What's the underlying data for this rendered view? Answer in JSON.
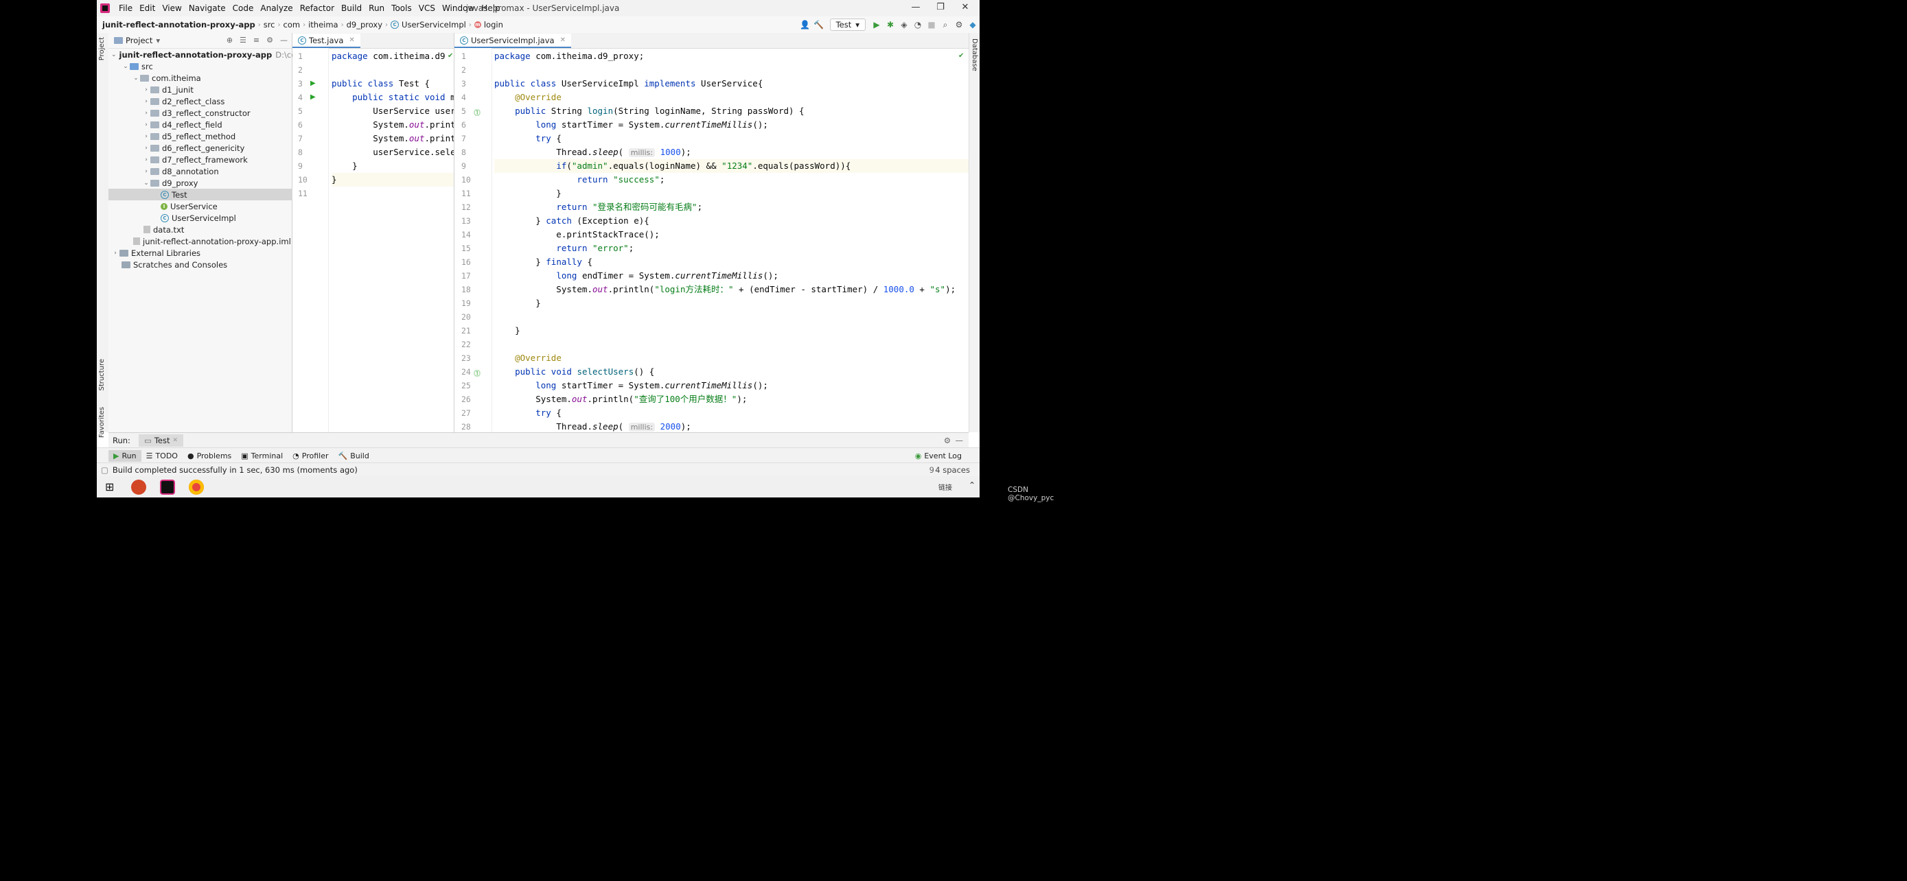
{
  "menu": [
    "File",
    "Edit",
    "View",
    "Navigate",
    "Code",
    "Analyze",
    "Refactor",
    "Build",
    "Run",
    "Tools",
    "VCS",
    "Window",
    "Help"
  ],
  "window_title": "javasepromax - UserServiceImpl.java",
  "breadcrumb": [
    "junit-reflect-annotation-proxy-app",
    "src",
    "com",
    "itheima",
    "d9_proxy",
    "UserServiceImpl",
    "login"
  ],
  "run_config": "Test",
  "project_panel": {
    "title": "Project",
    "root_name": "junit-reflect-annotation-proxy-app",
    "root_path": "D:\\code\\j",
    "src": "src",
    "package": "com.itheima",
    "folders": [
      "d1_junit",
      "d2_reflect_class",
      "d3_reflect_constructor",
      "d4_reflect_field",
      "d5_reflect_method",
      "d6_reflect_genericity",
      "d7_reflect_framework",
      "d8_annotation",
      "d9_proxy"
    ],
    "classes": [
      "Test",
      "UserService",
      "UserServiceImpl"
    ],
    "data_file": "data.txt",
    "iml_file": "junit-reflect-annotation-proxy-app.iml",
    "external_libraries": "External Libraries",
    "scratches": "Scratches and Consoles"
  },
  "left_tabs": {
    "project": "Project",
    "structure": "Structure",
    "favorites": "Favorites"
  },
  "right_tabs": {
    "database": "Database"
  },
  "editor_left": {
    "tab": "Test.java",
    "lines": [
      "package com.itheima.d9",
      "",
      "public class Test {",
      "    public static void m",
      "        UserService user",
      "        System.out.print",
      "        System.out.print",
      "        userService.sele",
      "    }",
      "}",
      ""
    ]
  },
  "editor_right": {
    "tab": "UserServiceImpl.java",
    "line_count": 28,
    "lines": {
      "l1_pkg": "package",
      "l1_rest": " com.itheima.d9_proxy;",
      "l3": "implements",
      "l5_login": "login",
      "l6_method": "currentTimeMillis",
      "l8_hint": "millis:",
      "l8_val": "1000",
      "l9_admin": "\"admin\"",
      "l9_pwd": "\"1234\"",
      "l10_success": "\"success\"",
      "l12_msg": "\"登录名和密码可能有毛病\"",
      "l15_error": "\"error\"",
      "l18_str": "\"login方法耗时：\"",
      "l18_num": "1000.0",
      "l18_s": "\"s\"",
      "l26_str": "\"查询了100个用户数据！\"",
      "l28_val": "2000"
    }
  },
  "run_panel": {
    "label": "Run:",
    "tab": "Test"
  },
  "tool_tabs": [
    "Run",
    "TODO",
    "Problems",
    "Terminal",
    "Profiler",
    "Build"
  ],
  "status": {
    "message": "Build completed successfully in 1 sec, 630 ms (moments ago)",
    "event_log": "Event Log",
    "indent": "4 spaces",
    "position": "9"
  },
  "taskbar": {
    "tray_text": "链接"
  },
  "watermark": "CSDN @Chovy_pyc",
  "colors": {
    "keyword": "#0033b3",
    "string": "#067d17",
    "annotation": "#9e880d",
    "number": "#1750eb"
  }
}
